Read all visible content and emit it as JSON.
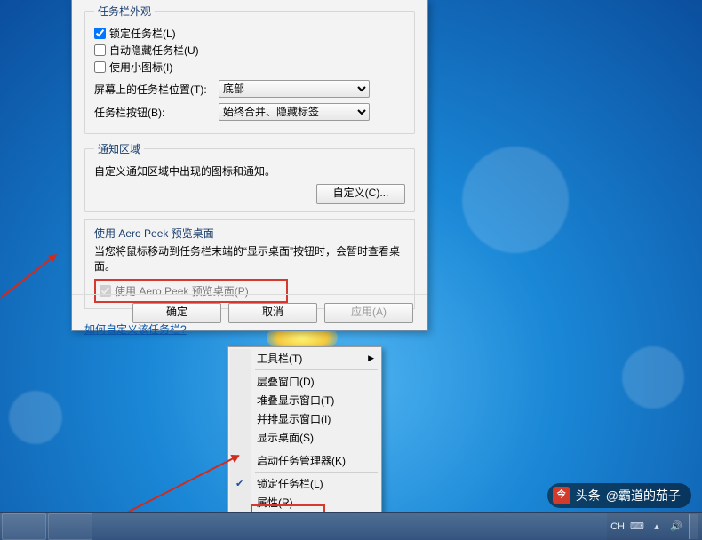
{
  "dialog": {
    "appearance": {
      "legend": "任务栏外观",
      "lock": "锁定任务栏(L)",
      "autohide": "自动隐藏任务栏(U)",
      "smallicons": "使用小图标(I)",
      "position_label": "屏幕上的任务栏位置(T):",
      "position_value": "底部",
      "buttons_label": "任务栏按钮(B):",
      "buttons_value": "始终合并、隐藏标签"
    },
    "notify": {
      "legend": "通知区域",
      "desc": "自定义通知区域中出现的图标和通知。",
      "customize_btn": "自定义(C)..."
    },
    "peek": {
      "title": "使用 Aero Peek 预览桌面",
      "desc": "当您将鼠标移动到任务栏末端的“显示桌面”按钮时，会暂时查看桌面。",
      "checkbox": "使用 Aero Peek 预览桌面(P)"
    },
    "link": "如何自定义该任务栏?",
    "ok": "确定",
    "cancel": "取消",
    "apply": "应用(A)"
  },
  "ctx": {
    "toolbars": "工具栏(T)",
    "cascade": "层叠窗口(D)",
    "stackh": "堆叠显示窗口(T)",
    "stackv": "并排显示窗口(I)",
    "showdesk": "显示桌面(S)",
    "taskmgr": "启动任务管理器(K)",
    "lock": "锁定任务栏(L)",
    "props": "属性(R)"
  },
  "tray": {
    "lang": "CH"
  },
  "watermark": {
    "prefix": "头条",
    "author": "@霸道的茄子"
  }
}
